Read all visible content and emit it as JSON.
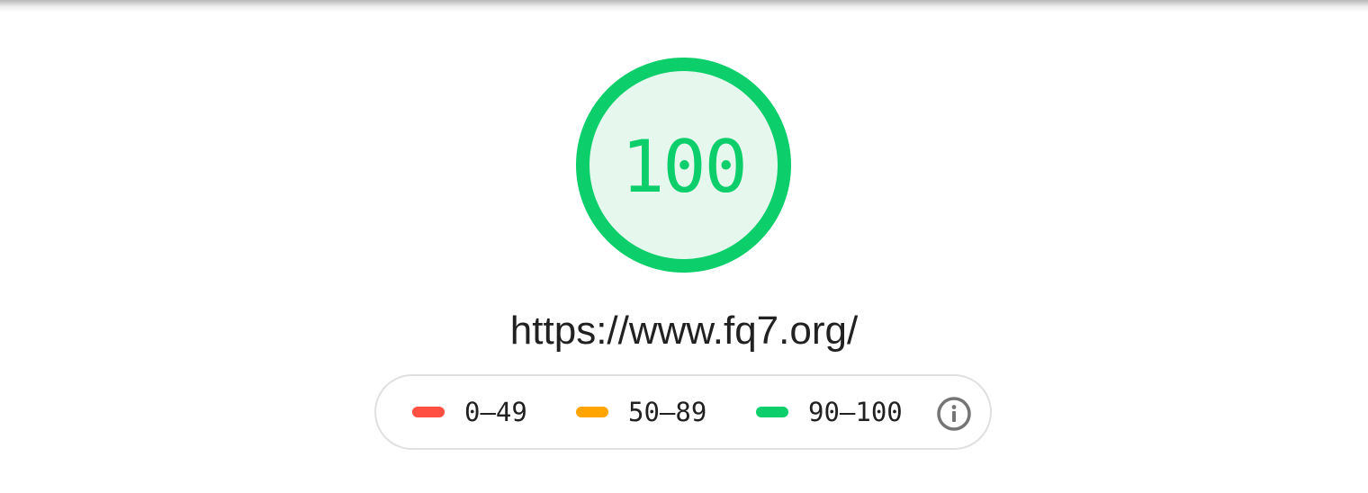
{
  "score": {
    "value": "100",
    "fraction": 1.0,
    "color": "#0cce6b",
    "fill_color": "#e6f8ee"
  },
  "url": {
    "text": "https://www.fq7.org/"
  },
  "legend": {
    "items": [
      {
        "range": "0–49",
        "color": "#ff4e42"
      },
      {
        "range": "50–89",
        "color": "#ffa400"
      },
      {
        "range": "90–100",
        "color": "#0cce6b"
      }
    ],
    "info_icon": "info-icon"
  }
}
